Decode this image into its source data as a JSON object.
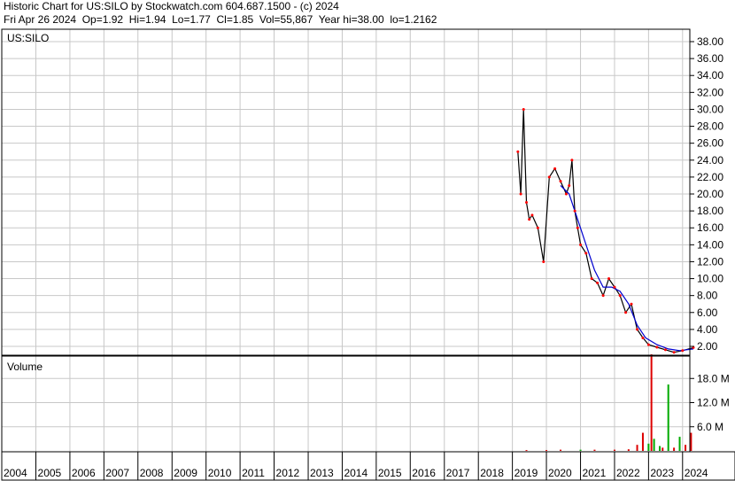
{
  "header": {
    "line1": "Historic Chart for US:SILO by Stockwatch.com 604.687.1500 - (c) 2024",
    "line2": "Fri Apr 26 2024  Op=1.92  Hi=1.94  Lo=1.77  Cl=1.85  Vol=55,867  Year hi=38.00  lo=1.2162"
  },
  "price_panel": {
    "symbol_label": "US:SILO",
    "y_ticks": [
      "38.00",
      "36.00",
      "34.00",
      "32.00",
      "30.00",
      "28.00",
      "26.00",
      "24.00",
      "22.00",
      "20.00",
      "18.00",
      "16.00",
      "14.00",
      "12.00",
      "10.00",
      "8.00",
      "6.00",
      "4.00",
      "2.00"
    ]
  },
  "volume_panel": {
    "label": "Volume",
    "y_ticks": [
      "18.0 M",
      "12.0 M",
      "6.0 M"
    ]
  },
  "x_axis": {
    "years": [
      "2004",
      "2005",
      "2006",
      "2007",
      "2008",
      "2009",
      "2010",
      "2011",
      "2012",
      "2013",
      "2014",
      "2015",
      "2016",
      "2017",
      "2018",
      "2019",
      "2020",
      "2021",
      "2022",
      "2023",
      "2024"
    ]
  },
  "colors": {
    "grid": "#c8c8c8",
    "price_bar": "#000000",
    "ma_short": "#e000e0",
    "ma_long": "#0000d0",
    "close_dot": "#ff0000",
    "volume_up": "#00aa00",
    "volume_down": "#dd0000"
  },
  "chart_data": {
    "type": "line",
    "title": "Historic Chart for US:SILO by Stockwatch.com 604.687.1500 - (c) 2024",
    "y_scale": "linear",
    "ylim": [
      0,
      39
    ],
    "xlim": [
      "2004-01-01",
      "2024-04-26"
    ],
    "grid": true,
    "series": [
      {
        "x": [
          "2019-03-01",
          "2019-04-01",
          "2019-05-01",
          "2019-06-01",
          "2019-07-01",
          "2019-08-01",
          "2019-10-01",
          "2019-12-01",
          "2020-02-01",
          "2020-04-01",
          "2020-06-01",
          "2020-08-01",
          "2020-09-01",
          "2020-10-01",
          "2020-11-01",
          "2020-12-01",
          "2021-01-01",
          "2021-03-01",
          "2021-05-01",
          "2021-07-01",
          "2021-09-01",
          "2021-11-01",
          "2022-01-01",
          "2022-03-01",
          "2022-05-01",
          "2022-07-01",
          "2022-09-01",
          "2022-11-01",
          "2023-01-01",
          "2023-04-01",
          "2023-07-01",
          "2023-10-01",
          "2024-01-01",
          "2024-04-26"
        ],
        "values": [
          25.0,
          20.0,
          30.0,
          19.0,
          17.0,
          17.5,
          16.0,
          12.0,
          22.0,
          23.0,
          21.5,
          20.0,
          21.0,
          24.0,
          18.0,
          16.0,
          14.0,
          13.0,
          10.0,
          9.5,
          8.0,
          10.0,
          9.0,
          8.0,
          6.0,
          7.0,
          4.0,
          3.0,
          2.2,
          1.9,
          1.6,
          1.3,
          1.5,
          1.85
        ]
      },
      {
        "x": [
          "2020-06-01",
          "2020-09-01",
          "2020-12-01",
          "2021-03-01",
          "2021-06-01",
          "2021-09-01",
          "2021-12-01",
          "2022-03-01",
          "2022-06-01",
          "2022-09-01",
          "2022-12-01",
          "2023-04-01",
          "2023-08-01",
          "2023-12-01",
          "2024-04-26"
        ],
        "values": [
          21.0,
          20.0,
          17.0,
          14.0,
          11.0,
          9.0,
          9.0,
          8.5,
          7.0,
          4.5,
          3.0,
          2.2,
          1.7,
          1.5,
          1.7
        ]
      }
    ],
    "volume": {
      "unit": "M",
      "ylim": [
        0,
        24
      ],
      "x": [
        "2019-06-01",
        "2020-01-01",
        "2020-06-01",
        "2021-01-01",
        "2021-06-01",
        "2022-01-01",
        "2022-06-01",
        "2022-09-01",
        "2022-11-01",
        "2023-01-01",
        "2023-02-01",
        "2023-03-01",
        "2023-05-01",
        "2023-06-01",
        "2023-08-01",
        "2023-10-01",
        "2023-12-01",
        "2024-02-01",
        "2024-04-01"
      ],
      "values": [
        0.2,
        0.2,
        0.3,
        0.3,
        0.3,
        0.3,
        0.4,
        1.5,
        4.5,
        1.8,
        24.0,
        3.0,
        1.2,
        0.8,
        16.5,
        0.8,
        3.5,
        1.5,
        4.5
      ],
      "direction": [
        "down",
        "down",
        "down",
        "up",
        "down",
        "down",
        "down",
        "down",
        "down",
        "up",
        "down",
        "up",
        "up",
        "down",
        "up",
        "down",
        "up",
        "down",
        "down"
      ]
    }
  }
}
